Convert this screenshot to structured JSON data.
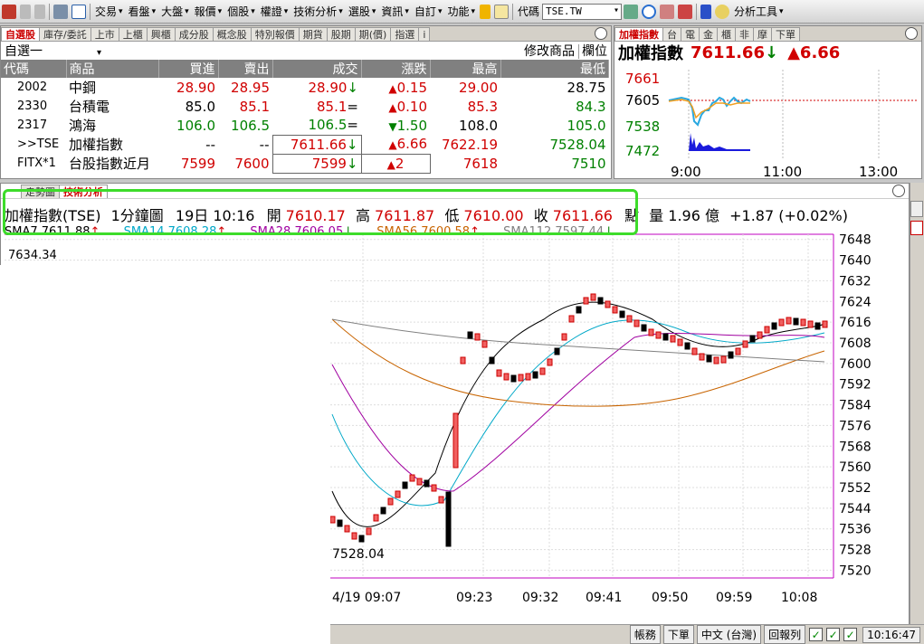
{
  "toolbar": {
    "menus": [
      "交易",
      "看盤",
      "大盤",
      "報價",
      "個股",
      "權證",
      "技術分析",
      "選股",
      "資訊",
      "自訂",
      "功能"
    ],
    "code_label": "代碼",
    "code_value": "TSE.TW",
    "tools_label": "分析工具"
  },
  "watch": {
    "tabs": [
      "自選股",
      "庫存/委託",
      "上市",
      "上櫃",
      "興櫃",
      "成分股",
      "概念股",
      "特別報價",
      "期貨",
      "股期",
      "期(價)",
      "指選",
      "i"
    ],
    "list_name": "自選一",
    "edit_label": "修改商品",
    "col_label": "欄位",
    "headers": [
      "代碼",
      "商品",
      "買進",
      "賣出",
      "成交",
      "漲跌",
      "最高",
      "最低"
    ],
    "rows": [
      {
        "code": "2002",
        "name": "中鋼",
        "bid": "28.90",
        "ask": "28.95",
        "last": "28.90",
        "lastmark": "↓",
        "chg": "0.15",
        "chgmark": "▲",
        "high": "29.00",
        "low": "28.75",
        "c": [
          "r",
          "r",
          "r",
          "r",
          "r",
          "k"
        ]
      },
      {
        "code": "2330",
        "name": "台積電",
        "bid": "85.0",
        "ask": "85.1",
        "last": "85.1",
        "lastmark": "=",
        "chg": "0.10",
        "chgmark": "▲",
        "high": "85.3",
        "low": "84.3",
        "c": [
          "k",
          "r",
          "r",
          "r",
          "r",
          "g"
        ]
      },
      {
        "code": "2317",
        "name": "鴻海",
        "bid": "106.0",
        "ask": "106.5",
        "last": "106.5",
        "lastmark": "=",
        "chg": "1.50",
        "chgmark": "▼",
        "high": "108.0",
        "low": "105.0",
        "c": [
          "g",
          "g",
          "g",
          "g",
          "k",
          "g"
        ]
      },
      {
        "code": ">>TSE",
        "name": "加權指數",
        "bid": "--",
        "ask": "--",
        "last": "7611.66",
        "lastmark": "↓",
        "chg": "6.66",
        "chgmark": "▲",
        "high": "7622.19",
        "low": "7528.04",
        "c": [
          "k",
          "k",
          "r",
          "r",
          "r",
          "g"
        ]
      },
      {
        "code": "FITX*1",
        "name": "台股指數近月",
        "bid": "7599",
        "ask": "7600",
        "last": "7599",
        "lastmark": "↓",
        "chg": "2",
        "chgmark": "▲",
        "high": "7618",
        "low": "7510",
        "c": [
          "r",
          "r",
          "r",
          "r",
          "r",
          "g"
        ]
      }
    ]
  },
  "index": {
    "tabs": [
      "加權指數",
      "台",
      "電",
      "金",
      "櫃",
      "非",
      "摩",
      "下單"
    ],
    "name": "加權指數",
    "value": "7611.66",
    "arrow": "↓",
    "change": "▲6.66",
    "y_labels": [
      "7661",
      "7605",
      "7538",
      "7472"
    ],
    "x_labels": [
      "9:00",
      "11:00",
      "13:00"
    ]
  },
  "chart": {
    "tabs": [
      "走勢圖",
      "技術分析"
    ],
    "symbol": "加權指數(TSE)",
    "period": "1分鐘圖",
    "date": "19日 10:16",
    "open_label": "開",
    "open": "7610.17",
    "high_label": "高",
    "high": "7611.87",
    "low_label": "低",
    "low": "7610.00",
    "close_label": "收",
    "close": "7611.66",
    "pts": "點",
    "vol_label": "量",
    "vol": "1.96",
    "vol_unit": "億",
    "change": "+1.87 (+0.02%)",
    "ma": [
      {
        "label": "SMA7 7611.88",
        "color": "#000000"
      },
      {
        "label": "SMA14 7608.28",
        "color": "#00a8c8"
      },
      {
        "label": "SMA28 7606.05",
        "color": "#a000a0"
      },
      {
        "label": "SMA56 7600.58",
        "color": "#c86400"
      },
      {
        "label": "SMA112 7597.44",
        "color": "#808080"
      }
    ],
    "top_price": "7634.34",
    "low_price": "7528.04"
  },
  "chart_data": {
    "type": "candlestick",
    "y_ticks": [
      7648,
      7640,
      7632,
      7624,
      7616,
      7608,
      7600,
      7592,
      7584,
      7576,
      7568,
      7560,
      7552,
      7544,
      7536,
      7528,
      7520
    ],
    "x_ticks": [
      "4/19 09:07",
      "09:23",
      "09:32",
      "09:41",
      "09:50",
      "09:59",
      "10:08"
    ],
    "ylim": [
      7517,
      7650
    ]
  },
  "status": {
    "items": [
      "帳務",
      "下單",
      "中文 (台灣)",
      "回報列"
    ],
    "time": "10:16:47"
  }
}
